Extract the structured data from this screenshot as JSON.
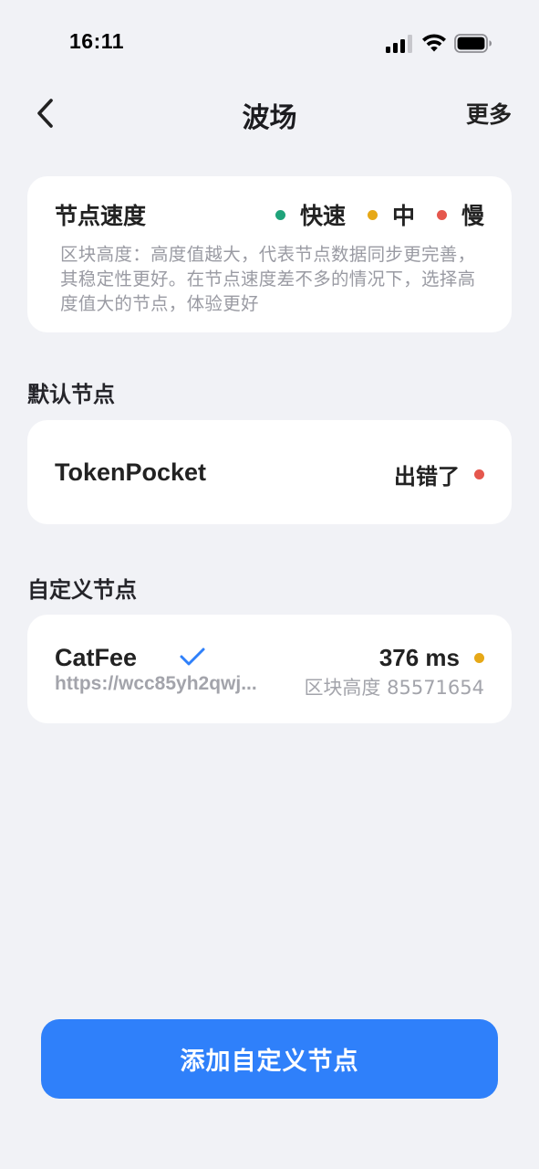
{
  "status_bar": {
    "time": "16:11",
    "icons": [
      "signal-icon",
      "wifi-icon",
      "battery-icon"
    ]
  },
  "nav": {
    "back_icon": "chevron-left-icon",
    "title": "波场",
    "more_label": "更多"
  },
  "speed_card": {
    "title": "节点速度",
    "legend": [
      {
        "label": "快速",
        "color": "#1fa37a"
      },
      {
        "label": "中",
        "color": "#e6a817"
      },
      {
        "label": "慢",
        "color": "#e5574d"
      }
    ],
    "description": "区块高度：高度值越大，代表节点数据同步更完善，其稳定性更好。在节点速度差不多的情况下，选择高度值大的节点，体验更好"
  },
  "default_section": {
    "title": "默认节点",
    "node": {
      "name": "TokenPocket",
      "status": "出错了",
      "status_color": "#e5574d"
    }
  },
  "custom_section": {
    "title": "自定义节点",
    "node": {
      "name": "CatFee",
      "selected_icon": "checkmark-icon",
      "latency": "376 ms",
      "latency_color": "#e6a817",
      "url": "https://wcc85yh2qwj...",
      "block_height": "区块高度 85571654"
    }
  },
  "add_button": {
    "label": "添加自定义节点",
    "color": "#2f80fa"
  }
}
